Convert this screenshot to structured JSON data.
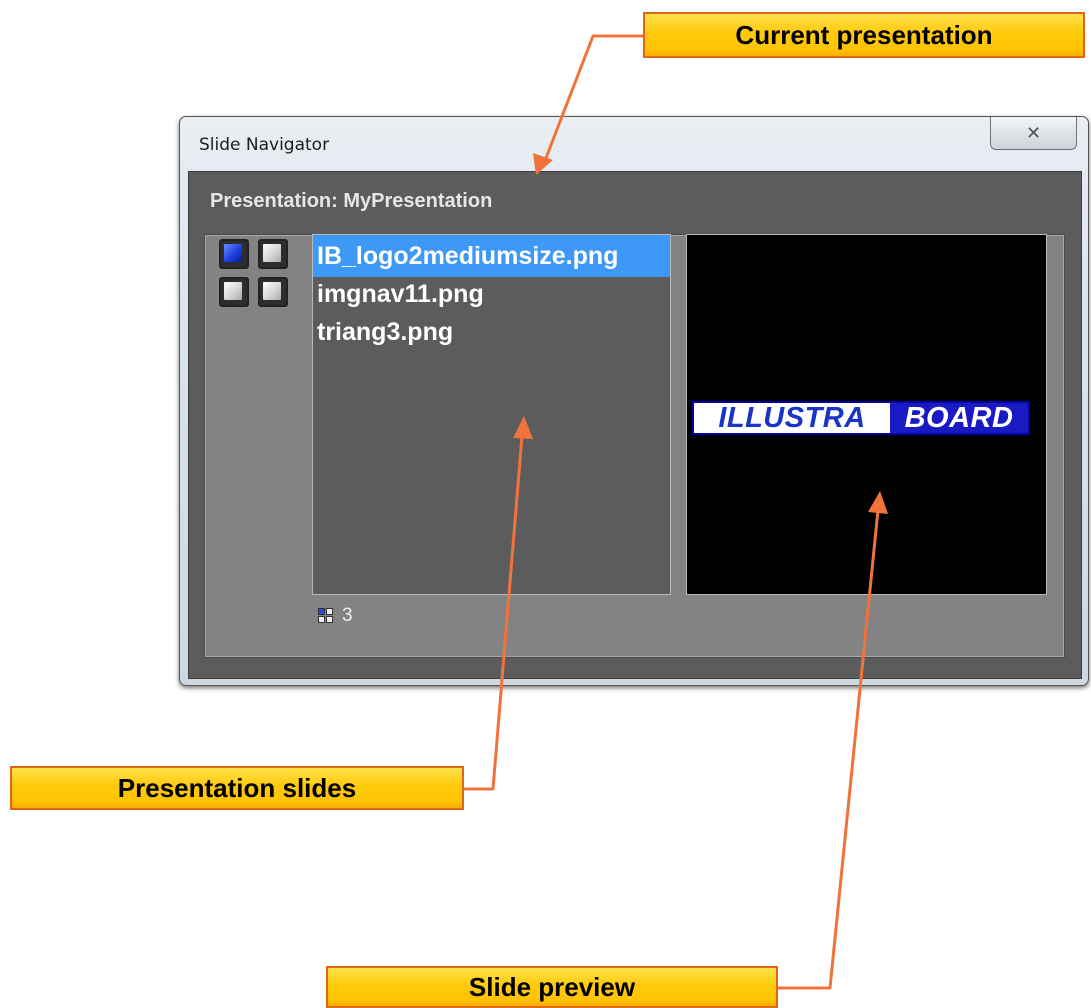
{
  "callouts": {
    "current": "Current presentation",
    "slides": "Presentation slides",
    "preview": "Slide preview"
  },
  "window": {
    "title": "Slide Navigator",
    "close_icon": "close-x-icon",
    "close_glyph": "✕"
  },
  "presentation": {
    "label": "Presentation: MyPresentation"
  },
  "layout_icons": [
    "layout-blue-square-icon",
    "layout-gray-square-icon",
    "layout-gray-square-icon",
    "layout-gray-square-icon"
  ],
  "slides": [
    {
      "name": "IB_logo2mediumsize.png",
      "selected": true
    },
    {
      "name": "imgnav11.png",
      "selected": false
    },
    {
      "name": "triang3.png",
      "selected": false
    }
  ],
  "slide_count": "3",
  "preview": {
    "logo_left": "ILLUSTRA",
    "logo_right": "BOARD"
  },
  "colors": {
    "callout_fill": "#ffc000",
    "callout_border": "#e0671a",
    "arrow": "#f0743a",
    "selection": "#3d99f5",
    "panel": "#5c5c5c"
  }
}
